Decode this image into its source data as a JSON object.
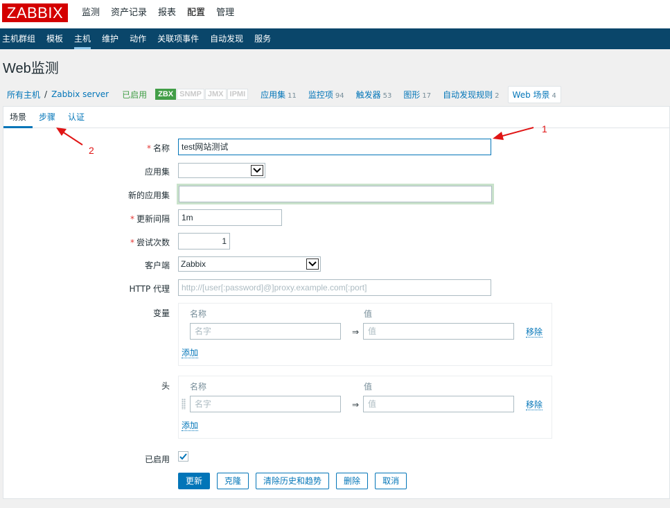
{
  "logo": "ZABBIX",
  "main_menu": [
    "监测",
    "资产记录",
    "报表",
    "配置",
    "管理"
  ],
  "sub_menu": [
    "主机群组",
    "模板",
    "主机",
    "维护",
    "动作",
    "关联项事件",
    "自动发现",
    "服务"
  ],
  "page_title": "Web监测",
  "host_nav": {
    "all_hosts": "所有主机",
    "separator": "/",
    "host": "Zabbix server",
    "status": "已启用",
    "availability": [
      "ZBX",
      "SNMP",
      "JMX",
      "IPMI"
    ],
    "items": [
      {
        "label": "应用集",
        "count": "11"
      },
      {
        "label": "监控项",
        "count": "94"
      },
      {
        "label": "触发器",
        "count": "53"
      },
      {
        "label": "图形",
        "count": "17"
      },
      {
        "label": "自动发现规则",
        "count": "2"
      },
      {
        "label": "Web 场景",
        "count": "4"
      }
    ]
  },
  "tabs": [
    "场景",
    "步骤",
    "认证"
  ],
  "form": {
    "name_label": "名称",
    "name_value": "test网站测试",
    "app_label": "应用集",
    "app_value": "",
    "new_app_label": "新的应用集",
    "new_app_value": "",
    "interval_label": "更新间隔",
    "interval_value": "1m",
    "attempts_label": "尝试次数",
    "attempts_value": "1",
    "agent_label": "客户端",
    "agent_value": "Zabbix",
    "proxy_label": "HTTP 代理",
    "proxy_placeholder": "http://[user[:password]@]proxy.example.com[:port]",
    "variables_label": "变量",
    "headers_label": "头",
    "col_name": "名称",
    "col_value": "值",
    "name_placeholder": "名字",
    "value_placeholder": "值",
    "arrow": "⇒",
    "remove": "移除",
    "add": "添加",
    "enabled_label": "已启用",
    "enabled_checked": true,
    "required_mark": "*"
  },
  "buttons": [
    "更新",
    "克隆",
    "清除历史和趋势",
    "删除",
    "取消"
  ],
  "annotations": [
    "1",
    "2"
  ],
  "colors": {
    "brand": "#d40000",
    "nav": "#0a466a",
    "link": "#0275b8",
    "annotation": "#e01515"
  }
}
